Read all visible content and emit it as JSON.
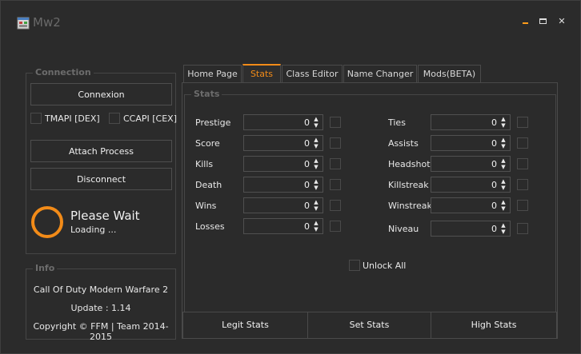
{
  "window": {
    "title": "Mw2",
    "icon": "app-window-icon",
    "controls": [
      "minimize-icon",
      "maximize-icon",
      "close-icon"
    ]
  },
  "connection": {
    "group_title": "Connection",
    "connect_label": "Connexion",
    "tmapi_label": "TMAPI [DEX]",
    "ccapi_label": "CCAPI [CEX]",
    "attach_label": "Attach Process",
    "disconnect_label": "Disconnect",
    "status_title": "Please Wait",
    "status_sub": "Loading ..."
  },
  "info": {
    "group_title": "Info",
    "game": "Call Of Duty Modern Warfare 2",
    "update": "Update : 1.14",
    "copyright": "Copyright © FFM | Team 2014-2015"
  },
  "tabs": [
    {
      "label": "Home Page"
    },
    {
      "label": "Stats"
    },
    {
      "label": "Class Editor"
    },
    {
      "label": "Name Changer"
    },
    {
      "label": "Mods(BETA)"
    }
  ],
  "stats": {
    "group_title": "Stats",
    "left": [
      {
        "label": "Prestige",
        "value": "0"
      },
      {
        "label": "Score",
        "value": "0"
      },
      {
        "label": "Kills",
        "value": "0"
      },
      {
        "label": "Death",
        "value": "0"
      },
      {
        "label": "Wins",
        "value": "0"
      },
      {
        "label": "Losses",
        "value": "0"
      }
    ],
    "right": [
      {
        "label": "Ties",
        "value": "0"
      },
      {
        "label": "Assists",
        "value": "0"
      },
      {
        "label": "Headshots",
        "value": "0"
      },
      {
        "label": "Killstreak",
        "value": "0"
      },
      {
        "label": "Winstreak",
        "value": "0"
      },
      {
        "label": "Niveau",
        "value": "0"
      }
    ],
    "unlock_all": "Unlock All"
  },
  "bottom": {
    "legit": "Legit Stats",
    "set": "Set Stats",
    "high": "High Stats"
  },
  "colors": {
    "accent": "#f28b18",
    "background": "#2b2b2b",
    "border": "#4a4a4a"
  }
}
